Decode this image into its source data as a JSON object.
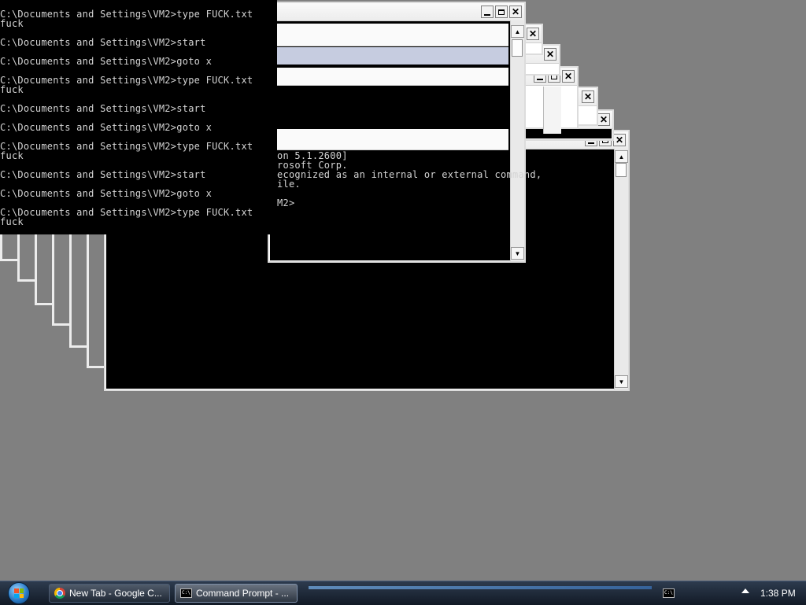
{
  "console_main": {
    "lines": [
      "C:\\Documents and Settings\\VM2>type FUCK.txt",
      "fuck",
      "",
      "C:\\Documents and Settings\\VM2>start",
      "",
      "C:\\Documents and Settings\\VM2>goto x",
      "",
      "C:\\Documents and Settings\\VM2>type FUCK.txt",
      "fuck",
      "",
      "C:\\Documents and Settings\\VM2>start",
      "",
      "C:\\Documents and Settings\\VM2>goto x",
      "",
      "C:\\Documents and Settings\\VM2>type FUCK.txt",
      "fuck",
      "",
      "C:\\Documents and Settings\\VM2>start",
      "",
      "C:\\Documents and Settings\\VM2>goto x",
      "",
      "C:\\Documents and Settings\\VM2>type FUCK.txt",
      "fuck"
    ]
  },
  "console_back": {
    "lines": [
      "on 5.1.2600]",
      "rosoft Corp.",
      "ecognized as an internal or external command,",
      "ile.",
      "",
      "M2>"
    ]
  },
  "taskbar": {
    "chrome_label": "New Tab - Google C...",
    "cmd_label": "Command Prompt - ...",
    "cmd_icon_text": "C:\\",
    "clock": "1:38 PM"
  },
  "icons": {
    "start": "windows-orb-icon",
    "chrome": "chrome-icon",
    "cmd": "cmd-icon",
    "tray": "show-hidden-icons-icon"
  }
}
